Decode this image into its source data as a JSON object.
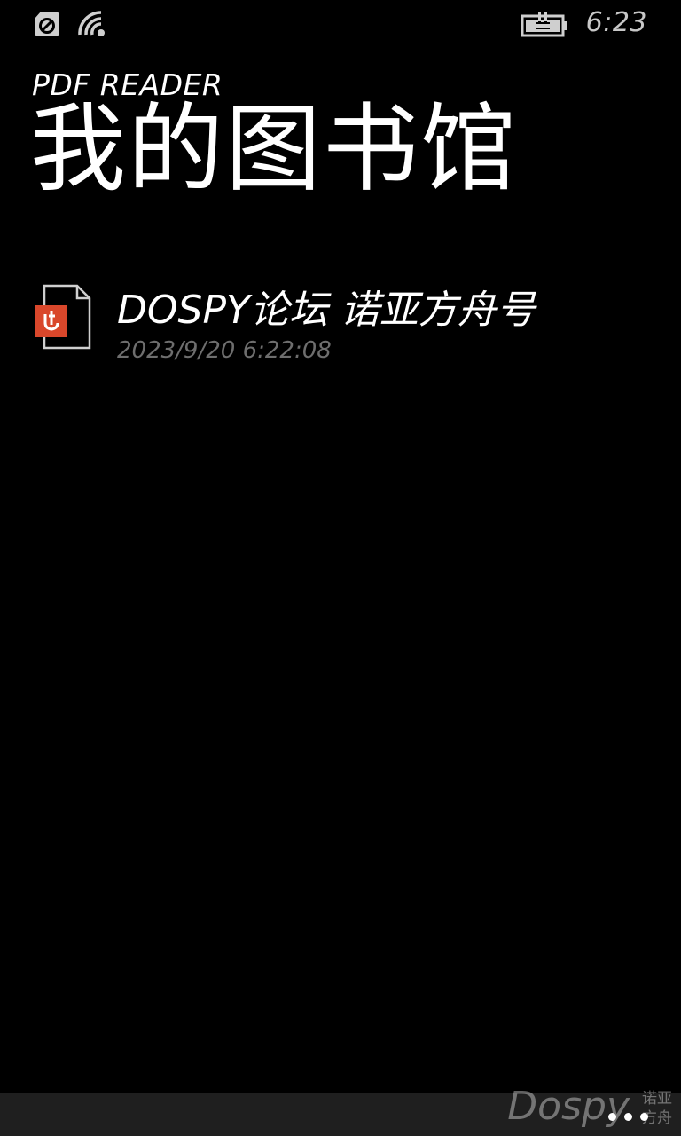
{
  "status_bar": {
    "time": "6:23",
    "icons": [
      "data-saver-icon",
      "wifi-icon",
      "battery-charging-icon"
    ]
  },
  "header": {
    "app_title": "PDF READER",
    "page_title": "我的图书馆"
  },
  "files": [
    {
      "name": "DOSPY论坛 诺亚方舟号",
      "date": "2023/9/20 6:22:08",
      "icon": "pdf-file-icon"
    }
  ],
  "app_bar": {
    "more_icon": "more-icon"
  },
  "watermark": {
    "text": "Dospy",
    "sub_line1": "诺亚",
    "sub_line2": "方舟"
  },
  "colors": {
    "background": "#000000",
    "text": "#ffffff",
    "secondary_text": "#6e6e6e",
    "pdf_accent": "#d9472b",
    "app_bar": "#1f1f1f"
  }
}
